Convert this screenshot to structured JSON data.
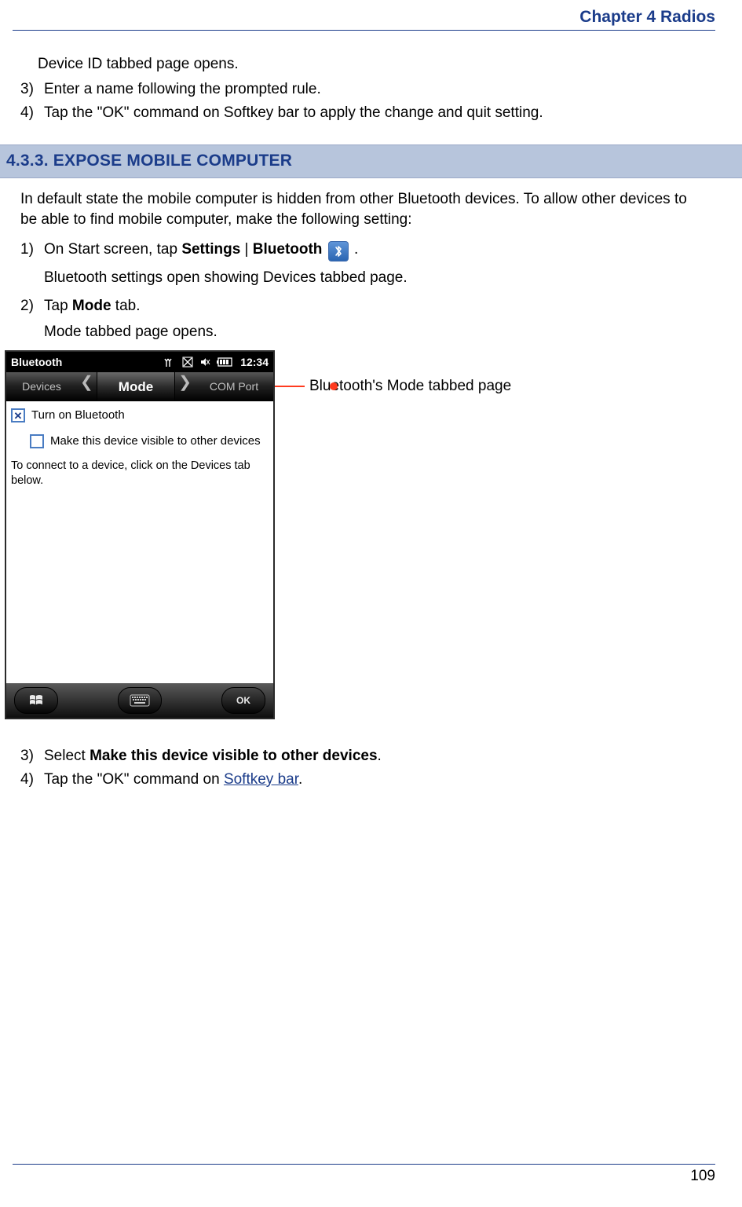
{
  "header": {
    "chapter": "Chapter 4 Radios"
  },
  "intro": {
    "line": "Device ID tabbed page opens.",
    "step3": "Enter a name following the prompted rule.",
    "step4": "Tap the \"OK\" command on Softkey bar to apply the change and quit setting."
  },
  "section": {
    "number": "4.3.3.",
    "title": "EXPOSE MOBILE COMPUTER",
    "intro": "In default state the mobile computer is hidden from other Bluetooth devices. To allow other devices to be able to find mobile computer, make the following setting:",
    "steps": {
      "s1_a": "On Start screen, tap ",
      "s1_b1": "Settings",
      "s1_sep": " | ",
      "s1_b2": "Bluetooth",
      "s1_c": " .",
      "s1_sub": "Bluetooth settings open showing Devices tabbed page.",
      "s2_a": "Tap ",
      "s2_b": "Mode",
      "s2_c": " tab.",
      "s2_sub": "Mode tabbed page opens.",
      "s3_a": "Select ",
      "s3_b": "Make this device visible to other devices",
      "s3_c": ".",
      "s4_a": "Tap the \"OK\" command on ",
      "s4_link": "Softkey bar",
      "s4_c": "."
    }
  },
  "device": {
    "title": "Bluetooth",
    "time": "12:34",
    "tabs": {
      "left": "Devices",
      "center": "Mode",
      "right": "COM Port"
    },
    "checkbox1": "Turn on Bluetooth",
    "checkbox2": "Make this device visible to other devices",
    "hint": "To connect to a device, click on the Devices tab below.",
    "ok": "OK"
  },
  "callout": "Bluetooth's Mode tabbed page",
  "page_number": "109",
  "numbers": {
    "n1": "1)",
    "n2": "2)",
    "n3": "3)",
    "n4": "4)"
  }
}
